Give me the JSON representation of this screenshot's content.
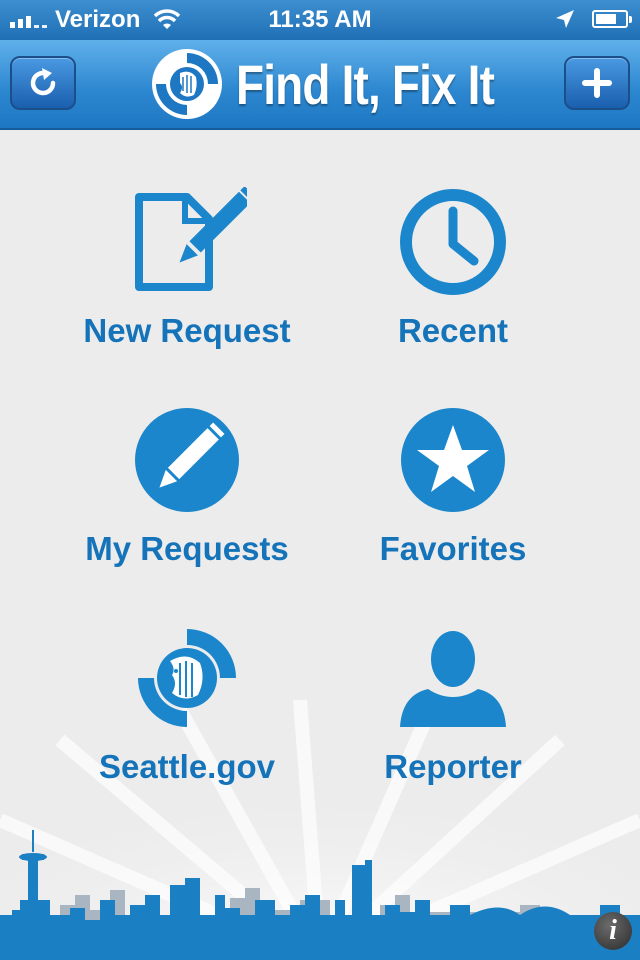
{
  "status_bar": {
    "carrier": "Verizon",
    "time": "11:35 AM",
    "icons": [
      "signal-icon",
      "wifi-icon",
      "location-arrow-icon",
      "battery-icon"
    ]
  },
  "nav": {
    "title": "Find It, Fix It",
    "left_button_icon": "refresh-icon",
    "right_button_icon": "plus-icon"
  },
  "menu": {
    "items": [
      {
        "label": "New Request",
        "icon": "new-request-icon"
      },
      {
        "label": "Recent",
        "icon": "clock-icon"
      },
      {
        "label": "My Requests",
        "icon": "pencil-circle-icon"
      },
      {
        "label": "Favorites",
        "icon": "star-icon"
      },
      {
        "label": "Seattle.gov",
        "icon": "seattle-seal-icon"
      },
      {
        "label": "Reporter",
        "icon": "person-icon"
      }
    ]
  },
  "footer": {
    "info_glyph": "i",
    "info_icon": "info-icon"
  },
  "colors": {
    "accent": "#1473b9",
    "nav_blue": "#2b86cf",
    "background": "#ececec"
  }
}
